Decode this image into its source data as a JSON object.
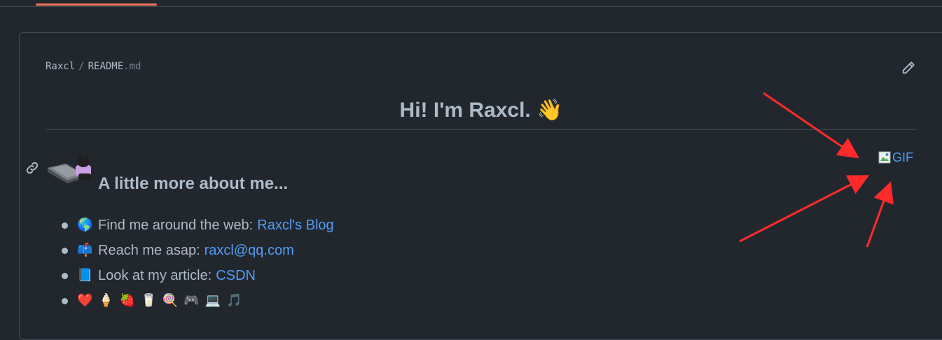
{
  "readme": {
    "owner": "Raxcl",
    "file_name": "README",
    "file_ext": ".md",
    "title": "Hi! I'm Raxcl. 👋",
    "section_heading": "A little more about me...",
    "broken_image_alt": "GIF",
    "items": [
      {
        "emoji": "🌎",
        "text": "Find me around the web:",
        "link": "Raxcl's Blog"
      },
      {
        "emoji": "📫",
        "text": "Reach me asap:",
        "link": "raxcl@qq.com"
      },
      {
        "emoji": "📘",
        "text": "Look at my article:",
        "link": "CSDN"
      }
    ],
    "emoji_row": [
      "❤️",
      "🍦",
      "🍓",
      "🥛",
      "🍭",
      "🎮",
      "💻",
      "🎵"
    ]
  },
  "colors": {
    "background": "#22272e",
    "border": "#444c56",
    "text": "#adbac7",
    "link": "#539bf5",
    "tab_accent": "#ec775c",
    "annotation_arrow": "#ff2a2a"
  },
  "icons": {
    "edit": "pencil-icon",
    "anchor": "link-icon"
  }
}
